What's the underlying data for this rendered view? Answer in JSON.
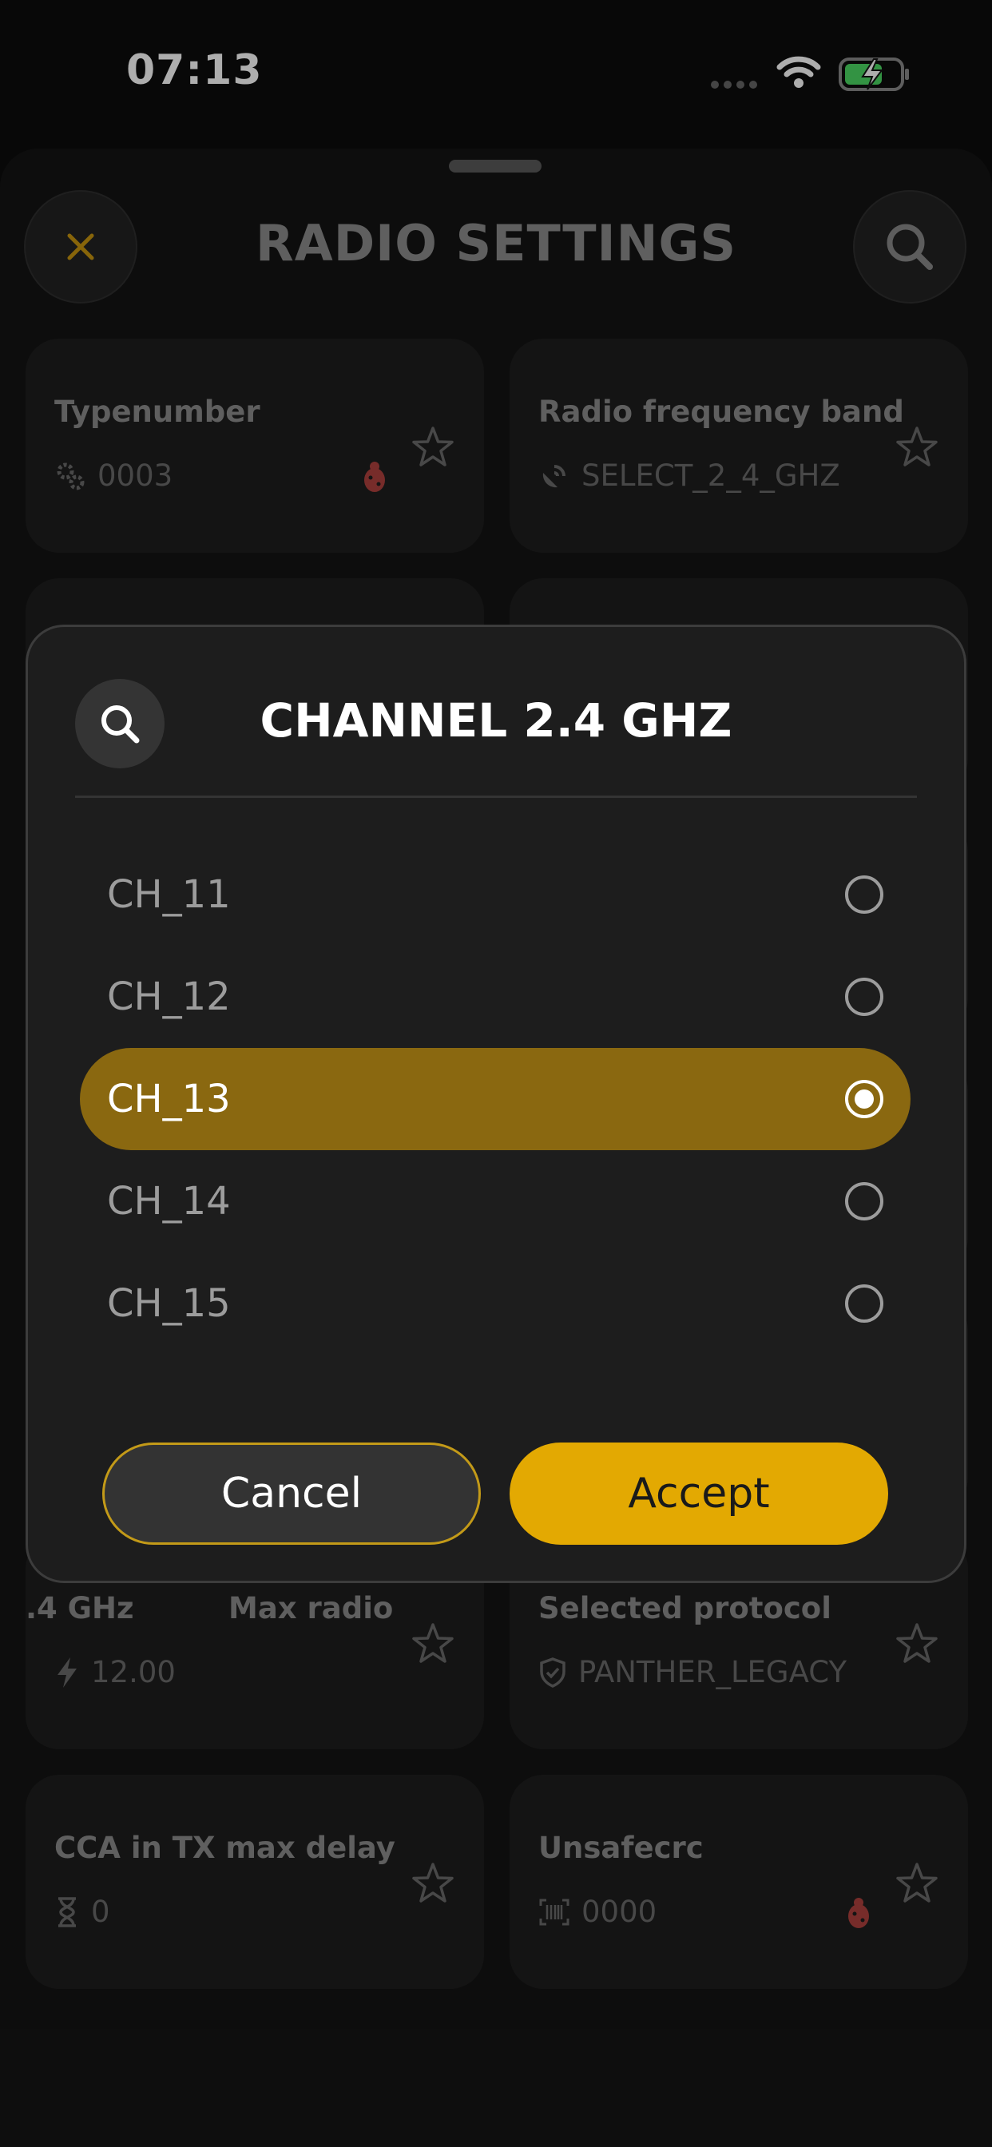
{
  "status_bar": {
    "time": "07:13"
  },
  "header": {
    "title": "RADIO SETTINGS"
  },
  "cards": [
    {
      "title": "Typenumber",
      "value": "0003",
      "icon": "gears-icon",
      "debug": true
    },
    {
      "title": "Radio frequency band",
      "value": "SELECT_2_4_GHZ",
      "icon": "satellite-dish-icon",
      "debug": false
    },
    {
      "title_a": ".4 GHz",
      "title_b": "Max radio",
      "value": "12.00",
      "icon": "bolt-icon",
      "debug": false
    },
    {
      "title": "Selected protocol",
      "value": "PANTHER_LEGACY",
      "icon": "shield-check-icon",
      "debug": false
    },
    {
      "title": "CCA in TX max delay",
      "value": "0",
      "icon": "hourglass-icon",
      "debug": false
    },
    {
      "title": "Unsafecrc",
      "value": "0000",
      "icon": "barcode-icon",
      "debug": true
    }
  ],
  "modal": {
    "title": "CHANNEL 2.4 GHZ",
    "options": [
      {
        "label": "CH_11",
        "selected": false
      },
      {
        "label": "CH_12",
        "selected": false
      },
      {
        "label": "CH_13",
        "selected": true
      },
      {
        "label": "CH_14",
        "selected": false
      },
      {
        "label": "CH_15",
        "selected": false
      }
    ],
    "cancel_label": "Cancel",
    "accept_label": "Accept"
  },
  "colors": {
    "accent": "#e3a902",
    "selected_row": "#8a6810",
    "debug_bug": "#b0413e"
  }
}
